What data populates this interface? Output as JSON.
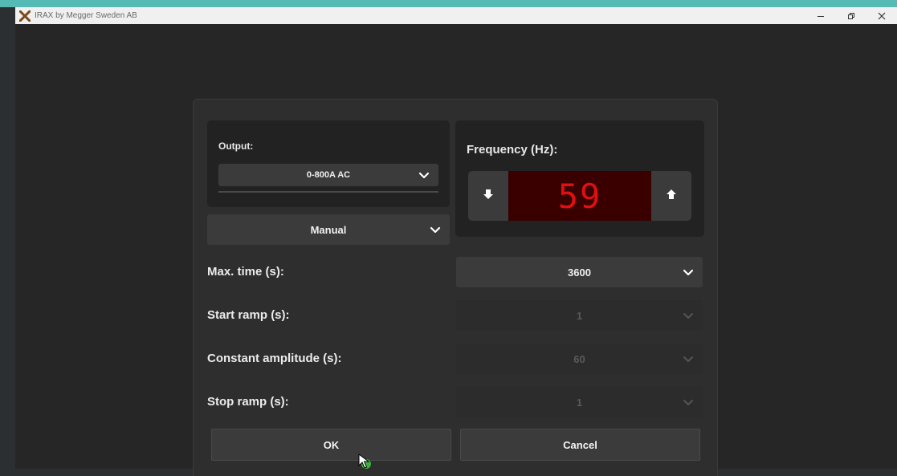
{
  "window": {
    "title": "IRAX by Megger Sweden AB",
    "minimize_icon": "minimize-icon",
    "restore_icon": "restore-icon",
    "close_icon": "close-icon"
  },
  "output": {
    "label": "Output:",
    "value": "0-800A AC"
  },
  "mode": {
    "value": "Manual"
  },
  "frequency": {
    "label": "Frequency (Hz):",
    "value": "59",
    "down_icon": "arrow-down-icon",
    "up_icon": "arrow-up-icon",
    "display_color": "#e01010"
  },
  "rows": [
    {
      "label": "Max. time (s):",
      "value": "3600",
      "enabled": true
    },
    {
      "label": "Start ramp (s):",
      "value": "1",
      "enabled": false
    },
    {
      "label": "Constant amplitude (s):",
      "value": "60",
      "enabled": false
    },
    {
      "label": "Stop ramp (s):",
      "value": "1",
      "enabled": false
    }
  ],
  "buttons": {
    "ok": "OK",
    "cancel": "Cancel"
  },
  "colors": {
    "accent": "#55b9b4",
    "background": "#262626"
  }
}
